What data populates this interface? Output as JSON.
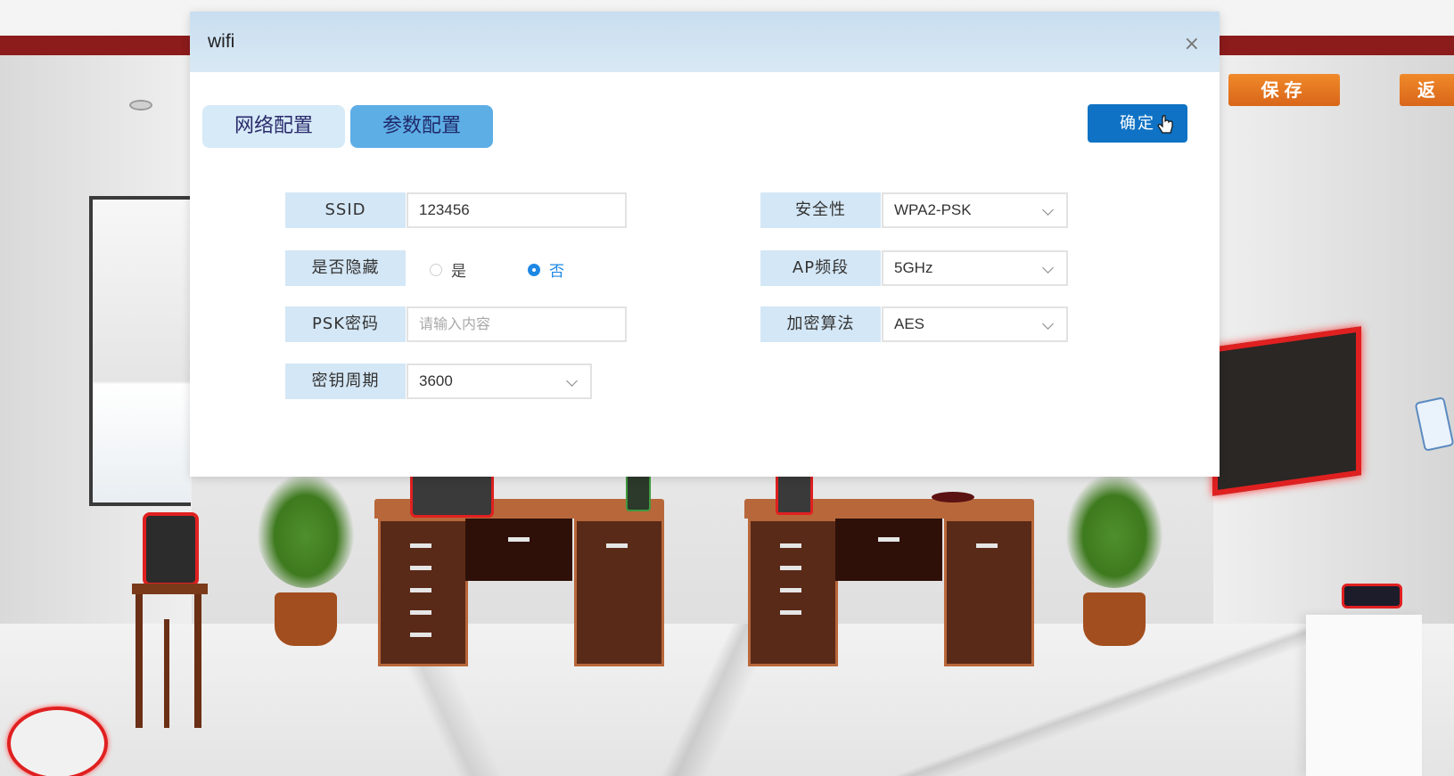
{
  "toolbar": {
    "save_label": "保存",
    "back_label": "返"
  },
  "dialog": {
    "title": "wifi",
    "close_icon": "×",
    "tabs": [
      {
        "label": "网络配置",
        "active": false
      },
      {
        "label": "参数配置",
        "active": true
      }
    ],
    "confirm_label": "确定",
    "fields": {
      "ssid": {
        "label": "SSID",
        "value": "123456"
      },
      "hidden": {
        "label": "是否隐藏",
        "options": [
          "是",
          "否"
        ],
        "selected": "否"
      },
      "psk": {
        "label": "PSK密码",
        "placeholder": "请输入内容",
        "value": ""
      },
      "key_period": {
        "label": "密钥周期",
        "value": "3600"
      },
      "security": {
        "label": "安全性",
        "value": "WPA2-PSK"
      },
      "ap_band": {
        "label": "AP频段",
        "value": "5GHz"
      },
      "encryption": {
        "label": "加密算法",
        "value": "AES"
      }
    }
  },
  "colors": {
    "accent": "#0f72c4",
    "tab_active": "#5eaee6",
    "label_bg": "#d4e7f6",
    "header_bg": "#c8def0",
    "orange": "#f08a2a",
    "highlight_red": "#e02020"
  },
  "icons": {
    "close": "close-icon",
    "chevron": "chevron-down-icon",
    "cursor": "pointer-hand-icon"
  }
}
